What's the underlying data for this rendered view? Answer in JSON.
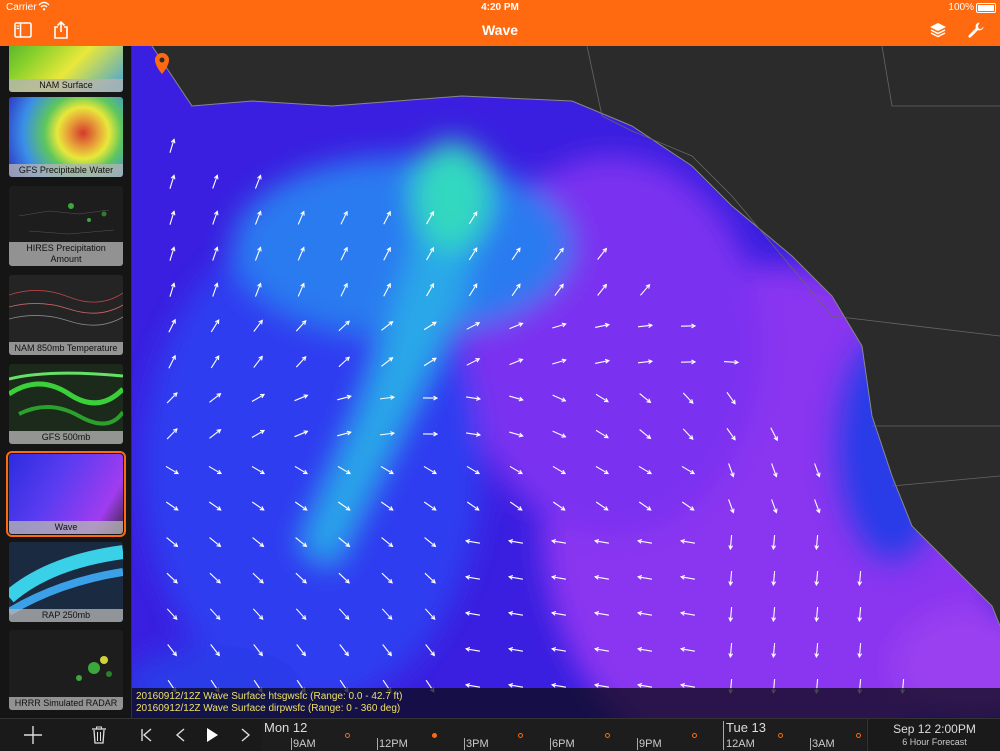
{
  "status_bar": {
    "carrier": "Carrier",
    "time": "4:20 PM",
    "battery": "100%"
  },
  "nav": {
    "title": "Wave",
    "icons": [
      "sidebar-toggle-icon",
      "share-icon",
      "layers-icon",
      "wrench-icon"
    ]
  },
  "colors": {
    "accent": "#ff6a10",
    "info_text": "#f0e060"
  },
  "sidebar": {
    "items": [
      {
        "label": "NAM Surface"
      },
      {
        "label": "GFS Precipitable Water"
      },
      {
        "label": "HIRES Precipitation Amount"
      },
      {
        "label": "NAM 850mb Temperature"
      },
      {
        "label": "GFS 500mb"
      },
      {
        "label": "Wave",
        "selected": true
      },
      {
        "label": "RAP 250mb"
      },
      {
        "label": "HRRR Simulated RADAR"
      }
    ]
  },
  "info": {
    "line1": "20160912/12Z Wave Surface htsgwsfc (Range: 0.0 - 42.7 ft)",
    "line2": "20160912/12Z Wave Surface dirpwsfc (Range: 0 - 360 deg)"
  },
  "timeline": {
    "days": [
      "Mon 12",
      "Tue 13"
    ],
    "hours": [
      "9AM",
      "12PM",
      "3PM",
      "6PM",
      "9PM",
      "12AM",
      "3AM"
    ]
  },
  "forecast": {
    "date": "Sep 12 2:00PM",
    "label": "6 Hour Forecast"
  },
  "toolbar_icons": [
    "add-icon",
    "trash-icon",
    "skip-start-icon",
    "previous-icon",
    "play-icon",
    "next-icon"
  ]
}
